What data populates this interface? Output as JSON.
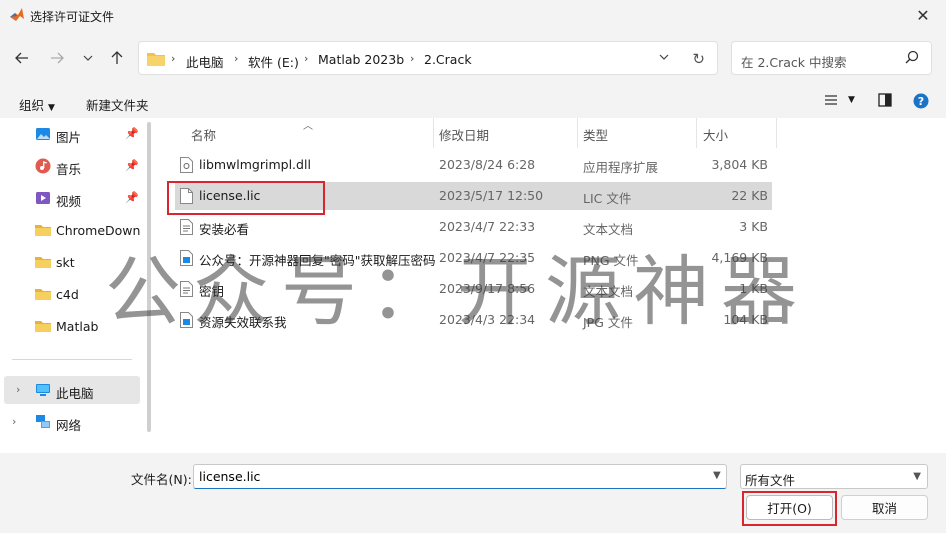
{
  "window": {
    "title": "选择许可证文件",
    "close": "✕"
  },
  "nav": {
    "breadcrumb": [
      "此电脑",
      "软件 (E:)",
      "Matlab 2023b",
      "2.Crack"
    ],
    "search_placeholder": "在 2.Crack 中搜索"
  },
  "toolbar": {
    "organize": "组织",
    "new_folder": "新建文件夹"
  },
  "sidebar": {
    "quick": [
      {
        "label": "图片",
        "icon": "pictures-icon",
        "pinned": true
      },
      {
        "label": "音乐",
        "icon": "music-icon",
        "pinned": true
      },
      {
        "label": "视频",
        "icon": "video-icon",
        "pinned": true
      },
      {
        "label": "ChromeDown",
        "icon": "folder-icon",
        "pinned": false
      },
      {
        "label": "skt",
        "icon": "folder-icon",
        "pinned": false
      },
      {
        "label": "c4d",
        "icon": "folder-icon",
        "pinned": false
      },
      {
        "label": "Matlab",
        "icon": "folder-icon",
        "pinned": false
      }
    ],
    "this_pc": "此电脑",
    "network": "网络"
  },
  "columns": {
    "name": "名称",
    "date": "修改日期",
    "type": "类型",
    "size": "大小"
  },
  "files": [
    {
      "name": "libmwlmgrimpl.dll",
      "date": "2023/8/24 6:28",
      "type": "应用程序扩展",
      "size": "3,804 KB",
      "icon": "dll-file-icon",
      "selected": false
    },
    {
      "name": "license.lic",
      "date": "2023/5/17 12:50",
      "type": "LIC 文件",
      "size": "22 KB",
      "icon": "file-icon",
      "selected": true
    },
    {
      "name": "安装必看",
      "date": "2023/4/7 22:33",
      "type": "文本文档",
      "size": "3 KB",
      "icon": "text-file-icon",
      "selected": false
    },
    {
      "name": "公众号：开源神器回复\"密码\"获取解压密码",
      "date": "2023/4/7 22:35",
      "type": "PNG 文件",
      "size": "4,169 KB",
      "icon": "image-file-icon",
      "selected": false
    },
    {
      "name": "密钥",
      "date": "2023/9/17 8:56",
      "type": "文本文档",
      "size": "1 KB",
      "icon": "text-file-icon",
      "selected": false
    },
    {
      "name": "资源失效联系我",
      "date": "2023/4/3 22:34",
      "type": "JPG 文件",
      "size": "104 KB",
      "icon": "image-file-icon",
      "selected": false
    }
  ],
  "watermark": "公众号：开源神器",
  "footer": {
    "filename_label": "文件名(N):",
    "filename_value": "license.lic",
    "filetype": "所有文件",
    "open": "打开(O)",
    "cancel": "取消"
  },
  "colors": {
    "highlight": "#d9262c",
    "folder": "#f2c24c",
    "selection": "#d9d9d9"
  }
}
